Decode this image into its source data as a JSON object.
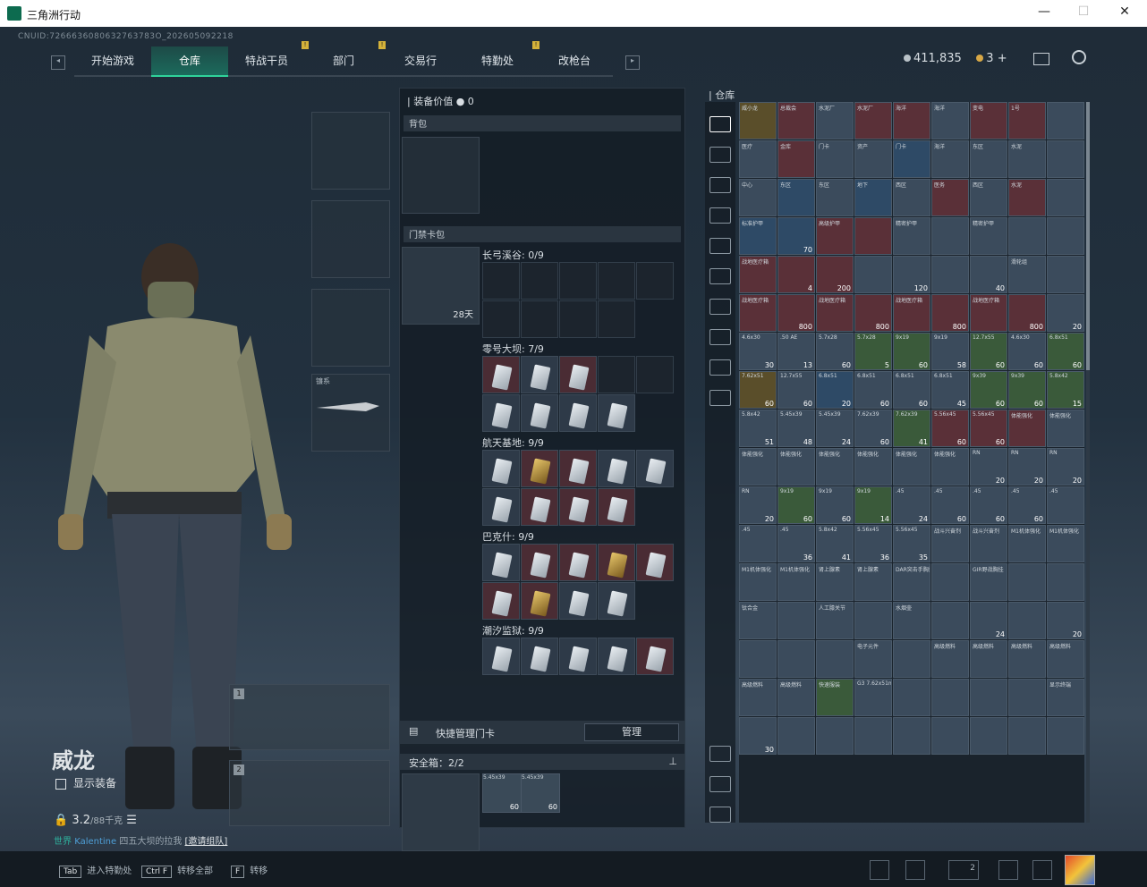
{
  "window": {
    "title": "三角洲行动",
    "buttons": [
      "—",
      "☐",
      "✕"
    ]
  },
  "uid": "CNUID:7266636080632763783O_202605092218",
  "nav": {
    "tabs": [
      "开始游戏",
      "仓库",
      "特战干员",
      "部门",
      "交易行",
      "特勤处",
      "改枪台"
    ],
    "active": "仓库"
  },
  "currency": {
    "coins": "411,835",
    "bonds": "3",
    "plus": "+"
  },
  "character": {
    "name": "威龙",
    "show_gear": "显示装备",
    "weight": "3.2",
    "weight_max": "/88千克"
  },
  "chat": {
    "world": "世界",
    "player": "Kalentine",
    "text": "四五大坝的拉我",
    "link": "[邀请组队]"
  },
  "weapon_slots": [
    "1",
    "2"
  ],
  "gear": {
    "melee_label": "镰系"
  },
  "equipment": {
    "value_label": "装备价值",
    "value": "0",
    "backpack": "背包",
    "keycard_bag": "门禁卡包",
    "keycard_timer": "28天",
    "areas": [
      {
        "name": "长弓溪谷: 0/9"
      },
      {
        "name": "零号大坝: 7/9"
      },
      {
        "name": "航天基地: 9/9"
      },
      {
        "name": "巴克什: 9/9"
      },
      {
        "name": "潮汐监狱: 9/9"
      }
    ],
    "quick_manage": "快捷管理门卡",
    "manage_btn": "管理",
    "safebox": "安全箱：2/2",
    "safe_ammo": [
      {
        "label": "5.45x39",
        "qty": "60"
      },
      {
        "label": "5.45x39",
        "qty": "60"
      }
    ]
  },
  "warehouse": {
    "title": "仓库",
    "items": [
      {
        "n": "威小龙",
        "q": "",
        "c": "y"
      },
      {
        "n": "总裁会",
        "q": "",
        "c": "r"
      },
      {
        "n": "水泥厂",
        "q": "",
        "c": ""
      },
      {
        "n": "水泥厂",
        "q": "",
        "c": "r"
      },
      {
        "n": "海洋",
        "q": "",
        "c": "r"
      },
      {
        "n": "海洋",
        "q": "",
        "c": ""
      },
      {
        "n": "变电",
        "q": "",
        "c": "r"
      },
      {
        "n": "1号",
        "q": "",
        "c": "r"
      },
      {
        "n": "",
        "q": "",
        "c": "dark"
      },
      {
        "n": "医疗",
        "q": "",
        "c": ""
      },
      {
        "n": "金库",
        "q": "",
        "c": "r"
      },
      {
        "n": "门卡",
        "q": "",
        "c": ""
      },
      {
        "n": "资产",
        "q": "",
        "c": ""
      },
      {
        "n": "门卡",
        "q": "",
        "c": "b"
      },
      {
        "n": "海洋",
        "q": "",
        "c": ""
      },
      {
        "n": "东区",
        "q": "",
        "c": ""
      },
      {
        "n": "水泥",
        "q": "",
        "c": ""
      },
      {
        "n": "",
        "q": "",
        "c": "dark"
      },
      {
        "n": "中心",
        "q": "",
        "c": ""
      },
      {
        "n": "东区",
        "q": "",
        "c": "b"
      },
      {
        "n": "东区",
        "q": "",
        "c": ""
      },
      {
        "n": "地下",
        "q": "",
        "c": "b"
      },
      {
        "n": "西区",
        "q": "",
        "c": ""
      },
      {
        "n": "医务",
        "q": "",
        "c": "r"
      },
      {
        "n": "西区",
        "q": "",
        "c": ""
      },
      {
        "n": "水泥",
        "q": "",
        "c": "r"
      },
      {
        "n": "",
        "q": "",
        "c": "dark"
      },
      {
        "n": "标准护甲",
        "q": "",
        "c": "b"
      },
      {
        "n": "",
        "q": "70",
        "c": "b"
      },
      {
        "n": "高级护甲",
        "q": "",
        "c": "r"
      },
      {
        "n": "",
        "q": "",
        "c": "r"
      },
      {
        "n": "精密护甲",
        "q": "",
        "c": ""
      },
      {
        "n": "",
        "q": "",
        "c": ""
      },
      {
        "n": "精密护甲",
        "q": "",
        "c": ""
      },
      {
        "n": "",
        "q": "",
        "c": ""
      },
      {
        "n": "",
        "q": "",
        "c": "dark"
      },
      {
        "n": "战地医疗箱",
        "q": "",
        "c": "r"
      },
      {
        "n": "",
        "q": "4",
        "c": "r"
      },
      {
        "n": "",
        "q": "200",
        "c": "r"
      },
      {
        "n": "",
        "q": "",
        "c": ""
      },
      {
        "n": "",
        "q": "120",
        "c": ""
      },
      {
        "n": "",
        "q": "",
        "c": ""
      },
      {
        "n": "",
        "q": "40",
        "c": ""
      },
      {
        "n": "滑轮组",
        "q": "",
        "c": ""
      },
      {
        "n": "",
        "q": "",
        "c": "dark"
      },
      {
        "n": "战地医疗箱",
        "q": "",
        "c": "r"
      },
      {
        "n": "",
        "q": "800",
        "c": "r"
      },
      {
        "n": "战地医疗箱",
        "q": "",
        "c": "r"
      },
      {
        "n": "",
        "q": "800",
        "c": "r"
      },
      {
        "n": "战地医疗箱",
        "q": "",
        "c": "r"
      },
      {
        "n": "",
        "q": "800",
        "c": "r"
      },
      {
        "n": "战地医疗箱",
        "q": "",
        "c": "r"
      },
      {
        "n": "",
        "q": "800",
        "c": "r"
      },
      {
        "n": "",
        "q": "20",
        "c": ""
      },
      {
        "n": "4.6x30",
        "q": "30",
        "c": ""
      },
      {
        "n": ".50 AE",
        "q": "13",
        "c": ""
      },
      {
        "n": "5.7x28",
        "q": "60",
        "c": ""
      },
      {
        "n": "5.7x28",
        "q": "5",
        "c": "g"
      },
      {
        "n": "9x19",
        "q": "60",
        "c": "g"
      },
      {
        "n": "9x19",
        "q": "58",
        "c": ""
      },
      {
        "n": "12.7x55",
        "q": "60",
        "c": "g"
      },
      {
        "n": "4.6x30",
        "q": "60",
        "c": ""
      },
      {
        "n": "6.8x51",
        "q": "60",
        "c": "g"
      },
      {
        "n": "7.62x51",
        "q": "60",
        "c": "y"
      },
      {
        "n": "12.7x55",
        "q": "60",
        "c": ""
      },
      {
        "n": "6.8x51",
        "q": "20",
        "c": "b"
      },
      {
        "n": "6.8x51",
        "q": "60",
        "c": ""
      },
      {
        "n": "6.8x51",
        "q": "60",
        "c": ""
      },
      {
        "n": "6.8x51",
        "q": "45",
        "c": ""
      },
      {
        "n": "9x39",
        "q": "60",
        "c": "g"
      },
      {
        "n": "9x39",
        "q": "60",
        "c": "g"
      },
      {
        "n": "5.8x42",
        "q": "15",
        "c": "g"
      },
      {
        "n": "5.8x42",
        "q": "51",
        "c": ""
      },
      {
        "n": "5.45x39",
        "q": "48",
        "c": ""
      },
      {
        "n": "5.45x39",
        "q": "24",
        "c": ""
      },
      {
        "n": "7.62x39",
        "q": "60",
        "c": ""
      },
      {
        "n": "7.62x39",
        "q": "41",
        "c": "g"
      },
      {
        "n": "5.56x45",
        "q": "60",
        "c": "r"
      },
      {
        "n": "5.56x45",
        "q": "60",
        "c": "r"
      },
      {
        "n": "体能强化",
        "q": "",
        "c": "r"
      },
      {
        "n": "体能强化",
        "q": "",
        "c": ""
      },
      {
        "n": "体能强化",
        "q": "",
        "c": ""
      },
      {
        "n": "体能强化",
        "q": "",
        "c": ""
      },
      {
        "n": "体能强化",
        "q": "",
        "c": ""
      },
      {
        "n": "体能强化",
        "q": "",
        "c": ""
      },
      {
        "n": "体能强化",
        "q": "",
        "c": ""
      },
      {
        "n": "体能强化",
        "q": "",
        "c": ""
      },
      {
        "n": "RN",
        "q": "20",
        "c": ""
      },
      {
        "n": "RN",
        "q": "20",
        "c": ""
      },
      {
        "n": "RN",
        "q": "20",
        "c": ""
      },
      {
        "n": "RN",
        "q": "20",
        "c": ""
      },
      {
        "n": "9x19",
        "q": "60",
        "c": "g"
      },
      {
        "n": "9x19",
        "q": "60",
        "c": ""
      },
      {
        "n": "9x19",
        "q": "14",
        "c": "g"
      },
      {
        "n": ".45",
        "q": "24",
        "c": ""
      },
      {
        "n": ".45",
        "q": "60",
        "c": ""
      },
      {
        "n": ".45",
        "q": "60",
        "c": ""
      },
      {
        "n": ".45",
        "q": "60",
        "c": ""
      },
      {
        "n": ".45",
        "q": "",
        "c": ""
      },
      {
        "n": ".45",
        "q": "",
        "c": ""
      },
      {
        "n": ".45",
        "q": "36",
        "c": ""
      },
      {
        "n": "5.8x42",
        "q": "41",
        "c": ""
      },
      {
        "n": "5.56x45",
        "q": "36",
        "c": ""
      },
      {
        "n": "5.56x45",
        "q": "35",
        "c": ""
      },
      {
        "n": "战斗兴奋剂",
        "q": "",
        "c": ""
      },
      {
        "n": "战斗兴奋剂",
        "q": "",
        "c": ""
      },
      {
        "n": "M1机体强化",
        "q": "",
        "c": ""
      },
      {
        "n": "M1机体强化",
        "q": "",
        "c": ""
      },
      {
        "n": "M1机体强化",
        "q": "",
        "c": ""
      },
      {
        "n": "M1机体强化",
        "q": "",
        "c": ""
      },
      {
        "n": "肾上腺素",
        "q": "",
        "c": ""
      },
      {
        "n": "肾上腺素",
        "q": "",
        "c": ""
      },
      {
        "n": "DAR突击手胸挂",
        "q": "",
        "c": ""
      },
      {
        "n": "",
        "q": "",
        "c": ""
      },
      {
        "n": "GIR野战胸挂",
        "q": "",
        "c": ""
      },
      {
        "n": "",
        "q": "",
        "c": ""
      },
      {
        "n": "",
        "q": "",
        "c": "dark"
      },
      {
        "n": "钛合金",
        "q": "",
        "c": ""
      },
      {
        "n": "",
        "q": "",
        "c": ""
      },
      {
        "n": "人工膝关节",
        "q": "",
        "c": ""
      },
      {
        "n": "",
        "q": "",
        "c": ""
      },
      {
        "n": "水烟壶",
        "q": "",
        "c": ""
      },
      {
        "n": "",
        "q": "",
        "c": ""
      },
      {
        "n": "",
        "q": "24",
        "c": ""
      },
      {
        "n": "",
        "q": "",
        "c": ""
      },
      {
        "n": "",
        "q": "20",
        "c": ""
      },
      {
        "n": "",
        "q": "",
        "c": ""
      },
      {
        "n": "",
        "q": "",
        "c": ""
      },
      {
        "n": "",
        "q": "",
        "c": ""
      },
      {
        "n": "电子元件",
        "q": "",
        "c": ""
      },
      {
        "n": "",
        "q": "",
        "c": ""
      },
      {
        "n": "高级燃料",
        "q": "",
        "c": ""
      },
      {
        "n": "高级燃料",
        "q": "",
        "c": ""
      },
      {
        "n": "高级燃料",
        "q": "",
        "c": ""
      },
      {
        "n": "高级燃料",
        "q": "",
        "c": ""
      },
      {
        "n": "高级燃料",
        "q": "",
        "c": ""
      },
      {
        "n": "高级燃料",
        "q": "",
        "c": ""
      },
      {
        "n": "快速服装",
        "q": "",
        "c": "g"
      },
      {
        "n": "G3 7.62x51mm",
        "q": "",
        "c": ""
      },
      {
        "n": "",
        "q": "",
        "c": ""
      },
      {
        "n": "",
        "q": "",
        "c": ""
      },
      {
        "n": "",
        "q": "",
        "c": ""
      },
      {
        "n": "",
        "q": "",
        "c": ""
      },
      {
        "n": "显示终端",
        "q": "",
        "c": ""
      },
      {
        "n": "",
        "q": "30",
        "c": ""
      },
      {
        "n": "",
        "q": "",
        "c": ""
      },
      {
        "n": "",
        "q": "",
        "c": ""
      },
      {
        "n": "",
        "q": "",
        "c": ""
      },
      {
        "n": "",
        "q": "",
        "c": ""
      },
      {
        "n": "",
        "q": "",
        "c": ""
      },
      {
        "n": "",
        "q": "",
        "c": ""
      },
      {
        "n": "",
        "q": "",
        "c": ""
      },
      {
        "n": "",
        "q": "",
        "c": ""
      }
    ]
  },
  "bottombar": {
    "hints": [
      {
        "key": "Tab",
        "label": "进入特勤处"
      },
      {
        "key": "Ctrl F",
        "label": "转移全部"
      },
      {
        "key": "F",
        "label": "转移"
      }
    ],
    "squad_count": "2"
  }
}
